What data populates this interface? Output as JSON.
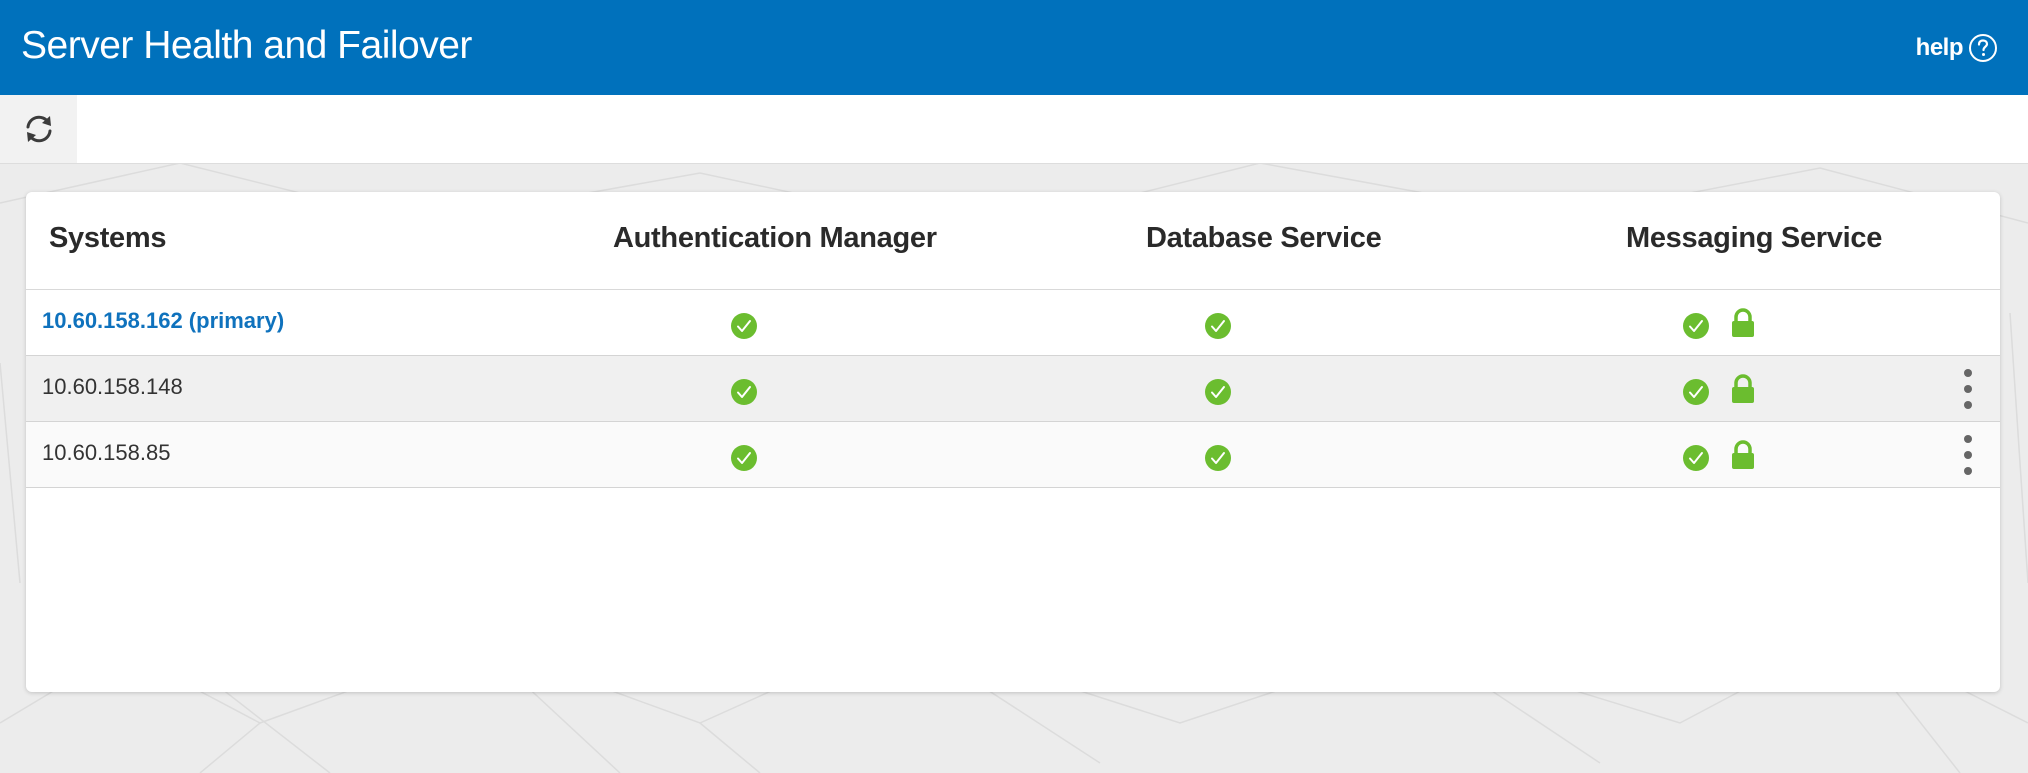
{
  "app": {
    "title": "Server Health and Failover",
    "help_label": "help"
  },
  "colors": {
    "header_bg": "#0071bc",
    "primary_link": "#0f72bd",
    "status_ok": "#6bbd2f",
    "lock": "#6bbd2f"
  },
  "toolbar": {
    "refresh_icon": "refresh-icon"
  },
  "table": {
    "columns": [
      "Systems",
      "Authentication Manager",
      "Database Service",
      "Messaging Service"
    ],
    "rows": [
      {
        "system": "10.60.158.162 (primary)",
        "auth_manager": "ok",
        "database_service": "ok",
        "messaging_service": "ok",
        "messaging_locked": true,
        "has_menu": false
      },
      {
        "system": "10.60.158.148",
        "auth_manager": "ok",
        "database_service": "ok",
        "messaging_service": "ok",
        "messaging_locked": true,
        "has_menu": true
      },
      {
        "system": "10.60.158.85",
        "auth_manager": "ok",
        "database_service": "ok",
        "messaging_service": "ok",
        "messaging_locked": true,
        "has_menu": true
      }
    ]
  }
}
